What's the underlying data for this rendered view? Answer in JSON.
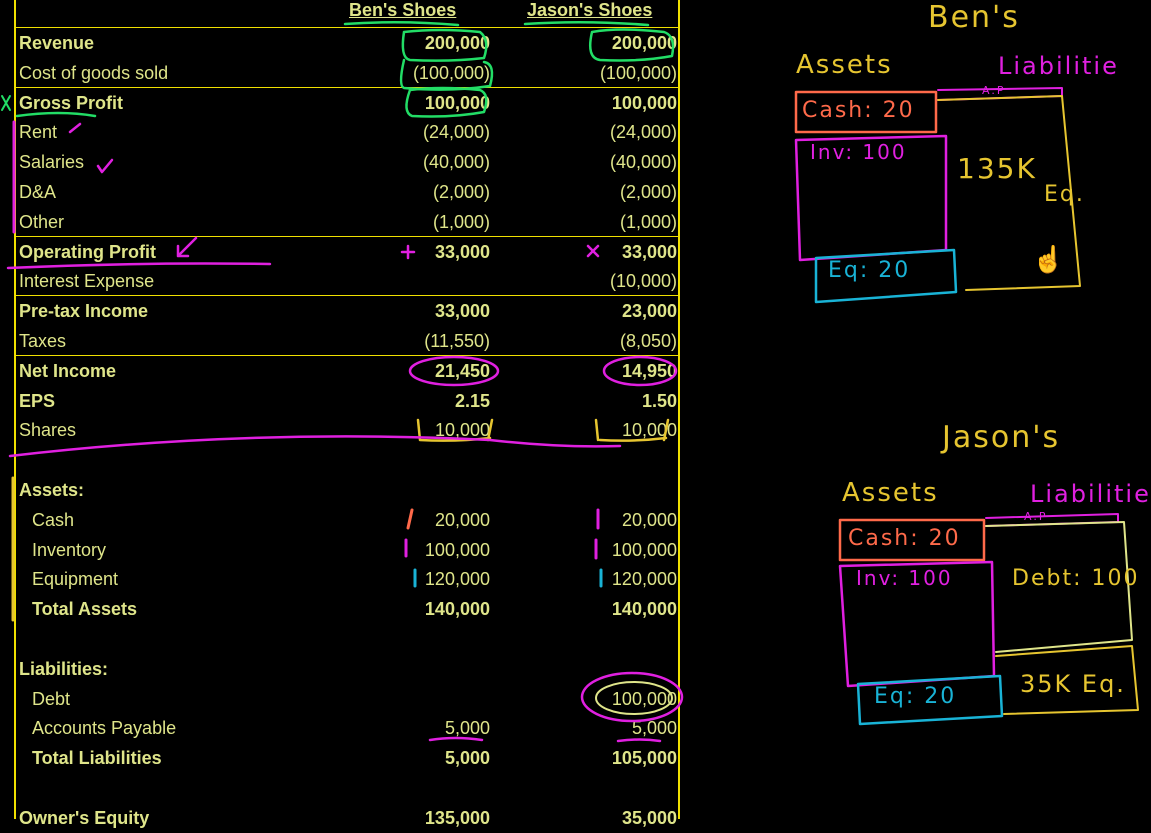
{
  "sheet": {
    "col_ben": "Ben's Shoes",
    "col_jason": "Jason's Shoes",
    "rows": [
      {
        "label": "Revenue",
        "ben": "200,000",
        "jason": "200,000",
        "bold": true
      },
      {
        "label": "Cost of goods sold",
        "ben": "(100,000)",
        "jason": "(100,000)",
        "bold": false
      },
      {
        "label": "Gross Profit",
        "ben": "100,000",
        "jason": "100,000",
        "bold": true
      },
      {
        "label": "Rent",
        "ben": "(24,000)",
        "jason": "(24,000)",
        "bold": false
      },
      {
        "label": "Salaries",
        "ben": "(40,000)",
        "jason": "(40,000)",
        "bold": false
      },
      {
        "label": "D&A",
        "ben": "(2,000)",
        "jason": "(2,000)",
        "bold": false
      },
      {
        "label": "Other",
        "ben": "(1,000)",
        "jason": "(1,000)",
        "bold": false
      },
      {
        "label": "Operating Profit",
        "ben": "33,000",
        "jason": "33,000",
        "bold": true
      },
      {
        "label": "Interest Expense",
        "ben": "",
        "jason": "(10,000)",
        "bold": false
      },
      {
        "label": "Pre-tax Income",
        "ben": "33,000",
        "jason": "23,000",
        "bold": true
      },
      {
        "label": "Taxes",
        "ben": "(11,550)",
        "jason": "(8,050)",
        "bold": false
      },
      {
        "label": "Net Income",
        "ben": "21,450",
        "jason": "14,950",
        "bold": true
      },
      {
        "label": "EPS",
        "ben": "2.15",
        "jason": "1.50",
        "bold": true
      },
      {
        "label": "Shares",
        "ben": "10,000",
        "jason": "10,000",
        "bold": false
      },
      {
        "label": "",
        "ben": "",
        "jason": "",
        "bold": false
      },
      {
        "label": "Assets:",
        "ben": "",
        "jason": "",
        "bold": true
      },
      {
        "label": "Cash",
        "ben": "20,000",
        "jason": "20,000",
        "bold": false,
        "indent": true
      },
      {
        "label": "Inventory",
        "ben": "100,000",
        "jason": "100,000",
        "bold": false,
        "indent": true
      },
      {
        "label": "Equipment",
        "ben": "120,000",
        "jason": "120,000",
        "bold": false,
        "indent": true
      },
      {
        "label": "Total Assets",
        "ben": "140,000",
        "jason": "140,000",
        "bold": true,
        "indent": true
      },
      {
        "label": "",
        "ben": "",
        "jason": "",
        "bold": false
      },
      {
        "label": "Liabilities:",
        "ben": "",
        "jason": "",
        "bold": true
      },
      {
        "label": "Debt",
        "ben": "",
        "jason": "100,000",
        "bold": false,
        "indent": true
      },
      {
        "label": "Accounts Payable",
        "ben": "5,000",
        "jason": "5,000",
        "bold": false,
        "indent": true
      },
      {
        "label": "Total Liabilities",
        "ben": "5,000",
        "jason": "105,000",
        "bold": true,
        "indent": true
      },
      {
        "label": "",
        "ben": "",
        "jason": "",
        "bold": false
      },
      {
        "label": "Owner's Equity",
        "ben": "135,000",
        "jason": "35,000",
        "bold": true
      }
    ]
  },
  "board": {
    "bens": {
      "title": "Ben's",
      "assets": "Assets",
      "liabilities": "Liabilitie",
      "ap": "A.P",
      "cash": "Cash: 20",
      "inv": "Inv: 100",
      "eq": "Eq: 20",
      "equity_value": "135K",
      "eq_label": "Eq."
    },
    "jasons": {
      "title": "Jason's",
      "assets": "Assets",
      "liabilities": "Liabilitie",
      "ap": "A.P",
      "cash": "Cash: 20",
      "inv": "Inv: 100",
      "eq": "Eq: 20",
      "debt": "Debt: 100",
      "equity": "35K Eq."
    }
  },
  "colors": {
    "sheet_text": "#dfe58a",
    "grid": "#f0e000",
    "pink": "#e020e0",
    "green": "#22dd66",
    "yellow": "#e6c530",
    "orange": "#ff6a4a",
    "cyan": "#19b3d6",
    "magenta": "#d23ed6"
  },
  "cursor_icon": "hand-pointer-icon"
}
